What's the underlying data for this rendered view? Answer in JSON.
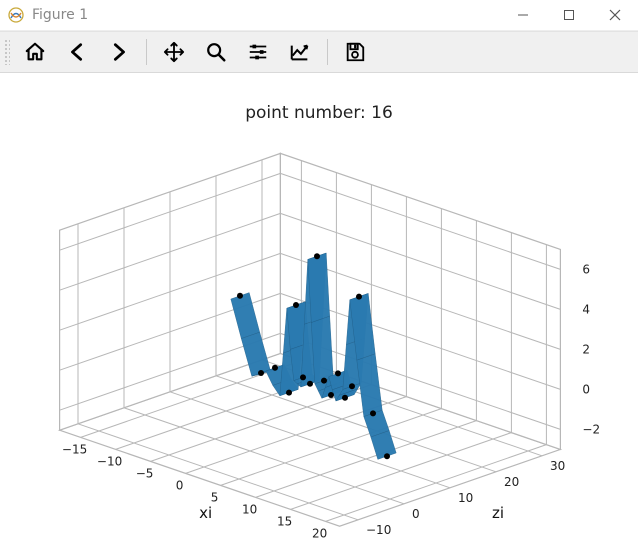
{
  "window": {
    "title": "Figure 1"
  },
  "toolbar": {
    "home": "Home",
    "back": "Back",
    "forward": "Forward",
    "pan": "Pan",
    "zoom": "Zoom",
    "subplots": "Configure subplots",
    "axes": "Edit axis",
    "save": "Save"
  },
  "chart_data": {
    "type": "3d-surface-with-scatter",
    "title": "point number: 16",
    "xlabel": "xi",
    "ylabel": "zi",
    "zlabel": "",
    "x_ticks": [
      -15,
      -10,
      -5,
      0,
      5,
      10,
      15,
      20
    ],
    "y_ticks": [
      -10,
      0,
      10,
      20,
      30
    ],
    "z_ticks": [
      -2,
      0,
      2,
      4,
      6
    ],
    "xlim": [
      -18,
      22
    ],
    "ylim": [
      -14,
      34
    ],
    "zlim": [
      -3,
      7
    ],
    "scatter_points": [
      {
        "x": -8,
        "y": 10,
        "z": 3.0
      },
      {
        "x": -5,
        "y": 10,
        "z": -0.5
      },
      {
        "x": -3,
        "y": 10,
        "z": 0.0
      },
      {
        "x": -1,
        "y": 10,
        "z": -1.0
      },
      {
        "x": 0,
        "y": 10,
        "z": 3.5
      },
      {
        "x": 1,
        "y": 10,
        "z": 0.0
      },
      {
        "x": 2,
        "y": 10,
        "z": -0.2
      },
      {
        "x": 3,
        "y": 10,
        "z": 6.3
      },
      {
        "x": 4,
        "y": 10,
        "z": 0.2
      },
      {
        "x": 5,
        "y": 10,
        "z": -0.4
      },
      {
        "x": 6,
        "y": 10,
        "z": 0.8
      },
      {
        "x": 7,
        "y": 10,
        "z": -0.3
      },
      {
        "x": 8,
        "y": 10,
        "z": 0.4
      },
      {
        "x": 9,
        "y": 10,
        "z": 5.0
      },
      {
        "x": 11,
        "y": 10,
        "z": -0.6
      },
      {
        "x": 13,
        "y": 10,
        "z": -2.5
      }
    ],
    "surface_profile": [
      {
        "x": -8,
        "z": 3.0
      },
      {
        "x": -6.5,
        "z": 1.2
      },
      {
        "x": -5,
        "z": -0.5
      },
      {
        "x": -4,
        "z": -0.3
      },
      {
        "x": -3,
        "z": 0.0
      },
      {
        "x": -2,
        "z": -0.6
      },
      {
        "x": -1,
        "z": -1.0
      },
      {
        "x": -0.5,
        "z": 1.2
      },
      {
        "x": 0,
        "z": 3.5
      },
      {
        "x": 0.5,
        "z": 1.5
      },
      {
        "x": 1,
        "z": 0.0
      },
      {
        "x": 1.5,
        "z": -0.1
      },
      {
        "x": 2,
        "z": -0.2
      },
      {
        "x": 2.5,
        "z": 3.0
      },
      {
        "x": 3,
        "z": 6.3
      },
      {
        "x": 3.5,
        "z": 3.2
      },
      {
        "x": 4,
        "z": 0.2
      },
      {
        "x": 4.5,
        "z": -0.1
      },
      {
        "x": 5,
        "z": -0.4
      },
      {
        "x": 5.5,
        "z": 0.2
      },
      {
        "x": 6,
        "z": 0.8
      },
      {
        "x": 6.5,
        "z": 0.2
      },
      {
        "x": 7,
        "z": -0.3
      },
      {
        "x": 7.5,
        "z": 0.05
      },
      {
        "x": 8,
        "z": 0.4
      },
      {
        "x": 8.5,
        "z": 2.7
      },
      {
        "x": 9,
        "z": 5.0
      },
      {
        "x": 10,
        "z": 2.1
      },
      {
        "x": 11,
        "z": -0.6
      },
      {
        "x": 12,
        "z": -1.5
      },
      {
        "x": 13,
        "z": -2.5
      }
    ],
    "surface_y_extent": [
      8,
      12
    ],
    "colors": {
      "surface": "#2a7ab0",
      "points": "#000000"
    }
  }
}
